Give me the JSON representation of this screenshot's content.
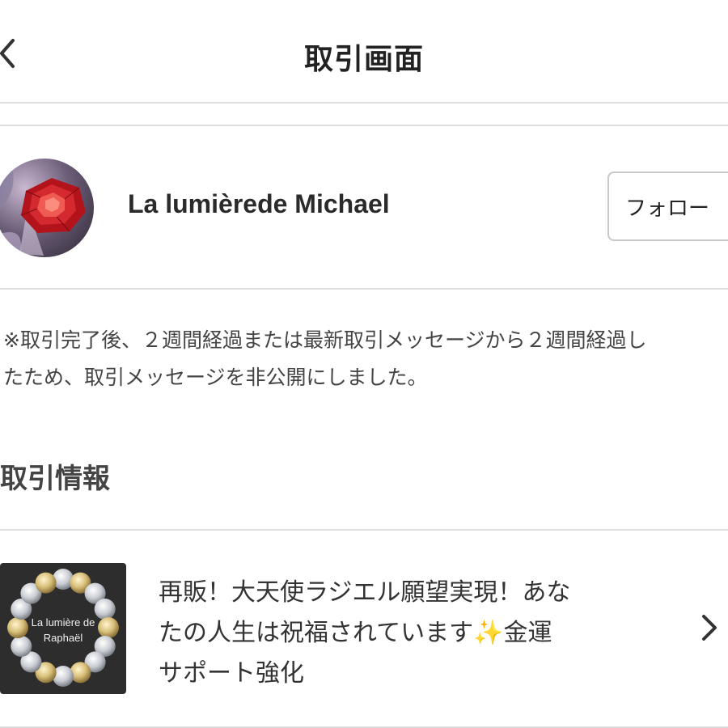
{
  "header": {
    "title": "取引画面",
    "back_icon": "chevron-left-icon"
  },
  "seller": {
    "name": "La lumièrede Michael",
    "follow_label": "フォロー"
  },
  "notice": {
    "lines": [
      "※取引完了後、２週間経過または最新取引メッセージから２週間経過し",
      "たため、取引メッセージを非公開にしました。"
    ]
  },
  "section": {
    "title": "取引情報"
  },
  "product": {
    "thumbnail_caption_lines": [
      "La lumière de",
      "Raphaël"
    ],
    "title_lines": [
      "再販！大天使ラジエル願望実現！あな",
      "たの人生は祝福されています✨金運",
      "サポート強化"
    ],
    "chevron_icon": "chevron-right-icon"
  },
  "colors": {
    "divider": "#dedede",
    "text": "#222222",
    "secondary_text": "#444444",
    "button_border": "#c9c9c9"
  }
}
